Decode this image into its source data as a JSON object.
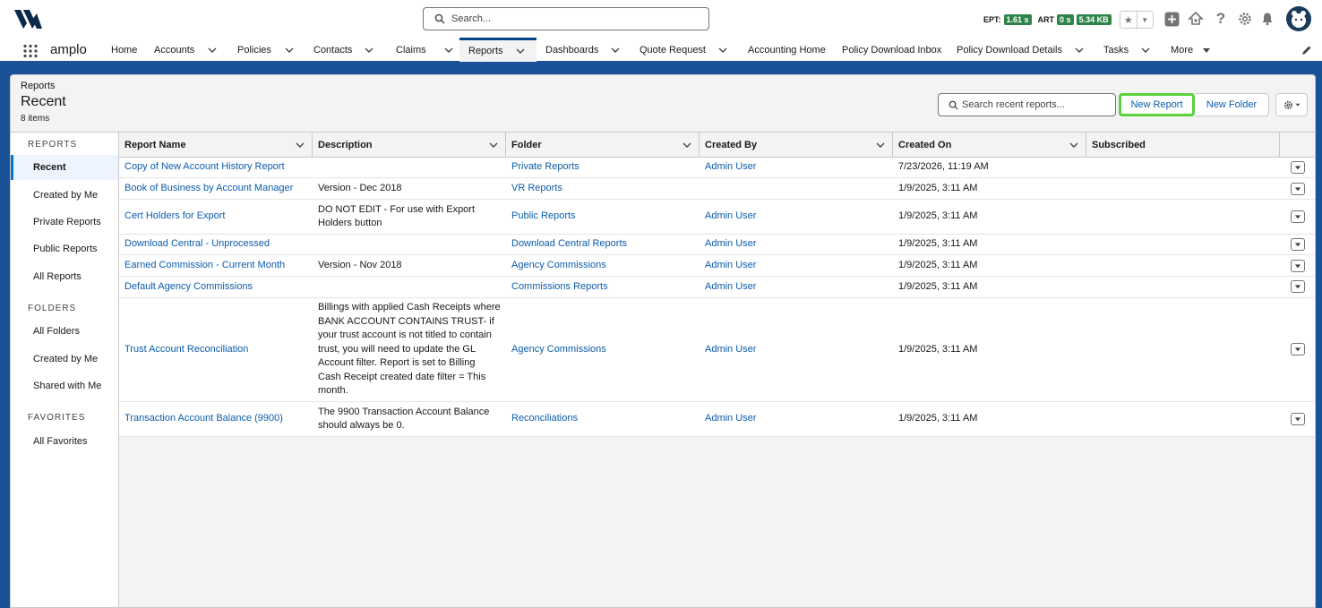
{
  "header": {
    "search_placeholder": "Search...",
    "metrics": [
      {
        "label": "EPT:",
        "value": "1.61 s"
      },
      {
        "label": "ART",
        "value": "0 s"
      },
      {
        "label": "",
        "value": "5.34 KB"
      }
    ]
  },
  "nav": {
    "app_name": "amplo",
    "items": [
      {
        "label": "Home",
        "has_menu": false
      },
      {
        "label": "Accounts",
        "has_menu": true
      },
      {
        "label": "Policies",
        "has_menu": true
      },
      {
        "label": "Contacts",
        "has_menu": true
      },
      {
        "label": "Claims",
        "has_menu": true
      },
      {
        "label": "Reports",
        "has_menu": true,
        "active": true
      },
      {
        "label": "Dashboards",
        "has_menu": true
      },
      {
        "label": "Quote Request",
        "has_menu": true
      },
      {
        "label": "Accounting Home",
        "has_menu": false
      },
      {
        "label": "Policy Download Inbox",
        "has_menu": false
      },
      {
        "label": "Policy Download Details",
        "has_menu": true
      },
      {
        "label": "Tasks",
        "has_menu": true
      },
      {
        "label": "More",
        "has_menu": true
      }
    ]
  },
  "page": {
    "breadcrumb": "Reports",
    "title": "Recent",
    "count": "8 items",
    "search_placeholder": "Search recent reports...",
    "new_report": "New Report",
    "new_folder": "New Folder"
  },
  "sidebar": {
    "reports_heading": "REPORTS",
    "reports": [
      "Recent",
      "Created by Me",
      "Private Reports",
      "Public Reports",
      "All Reports"
    ],
    "folders_heading": "FOLDERS",
    "folders": [
      "All Folders",
      "Created by Me",
      "Shared with Me"
    ],
    "favorites_heading": "FAVORITES",
    "favorites": [
      "All Favorites"
    ]
  },
  "table": {
    "columns": [
      "Report Name",
      "Description",
      "Folder",
      "Created By",
      "Created On",
      "Subscribed"
    ],
    "rows": [
      {
        "name": "Copy of New Account History Report",
        "description": "",
        "folder": "Private Reports",
        "created_by": "Admin User",
        "created_on": "7/23/2026, 11:19 AM"
      },
      {
        "name": "Book of Business by Account Manager",
        "description": "Version - Dec 2018",
        "folder": "VR Reports",
        "created_by": "",
        "created_on": "1/9/2025, 3:11 AM"
      },
      {
        "name": "Cert Holders for Export",
        "description": "DO NOT EDIT - For use with Export Holders button",
        "folder": "Public Reports",
        "created_by": "Admin User",
        "created_on": "1/9/2025, 3:11 AM"
      },
      {
        "name": "Download Central - Unprocessed",
        "description": "",
        "folder": "Download Central Reports",
        "created_by": "Admin User",
        "created_on": "1/9/2025, 3:11 AM"
      },
      {
        "name": "Earned Commission - Current Month",
        "description": "Version - Nov 2018",
        "folder": "Agency Commissions",
        "created_by": "Admin User",
        "created_on": "1/9/2025, 3:11 AM"
      },
      {
        "name": "Default Agency Commissions",
        "description": "",
        "folder": "Commissions Reports",
        "created_by": "Admin User",
        "created_on": "1/9/2025, 3:11 AM"
      },
      {
        "name": "Trust Account Reconciliation",
        "description": "Billings with applied Cash Receipts where BANK ACCOUNT CONTAINS TRUST- if your trust account is not titled to contain trust, you will need to update the GL Account filter. Report is set to Billing Cash Receipt created date filter = This month.",
        "folder": "Agency Commissions",
        "created_by": "Admin User",
        "created_on": "1/9/2025, 3:11 AM"
      },
      {
        "name": "Transaction Account Balance (9900)",
        "description": "The 9900 Transaction Account Balance should always be 0.",
        "folder": "Reconciliations",
        "created_by": "Admin User",
        "created_on": "1/9/2025, 3:11 AM"
      }
    ]
  }
}
